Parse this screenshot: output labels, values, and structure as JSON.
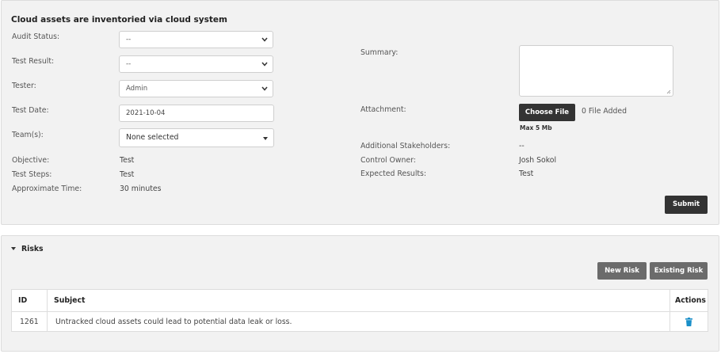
{
  "test_panel": {
    "title": "Cloud assets are inventoried via cloud system",
    "audit_status": {
      "label": "Audit Status:",
      "value": "--"
    },
    "test_result": {
      "label": "Test Result:",
      "value": "--"
    },
    "tester": {
      "label": "Tester:",
      "value": "Admin"
    },
    "test_date": {
      "label": "Test Date:",
      "value": "2021-10-04"
    },
    "teams": {
      "label": "Team(s):",
      "value": "None selected"
    },
    "objective": {
      "label": "Objective:",
      "value": "Test"
    },
    "test_steps": {
      "label": "Test Steps:",
      "value": "Test"
    },
    "approximate_time": {
      "label": "Approximate Time:",
      "value": "30 minutes"
    },
    "summary": {
      "label": "Summary:",
      "value": ""
    },
    "attachment": {
      "label": "Attachment:",
      "button": "Choose File",
      "status": "0 File Added",
      "max_size": "Max 5 Mb"
    },
    "additional_stakeholders": {
      "label": "Additional Stakeholders:",
      "value": "--"
    },
    "control_owner": {
      "label": "Control Owner:",
      "value": "Josh Sokol"
    },
    "expected_results": {
      "label": "Expected Results:",
      "value": "Test"
    },
    "submit_label": "Submit"
  },
  "risks_panel": {
    "toggle_label": "Risks",
    "new_risk_label": "New Risk",
    "existing_risk_label": "Existing Risk",
    "table": {
      "headers": [
        "ID",
        "Subject",
        "Actions"
      ],
      "rows": [
        {
          "id": "1261",
          "subject": "Untracked cloud assets could lead to potential data leak or loss."
        }
      ]
    }
  },
  "colors": {
    "panel_bg": "#f2f2f2",
    "dark_button": "#333333",
    "gray_button": "#6b6b6b",
    "trash_icon": "#1a8fc9"
  },
  "icons": {
    "select_chevron": "chevron-down-icon",
    "multiselect_caret": "caret-down-icon",
    "risks_toggle": "caret-down-icon",
    "row_delete": "trash-icon"
  }
}
